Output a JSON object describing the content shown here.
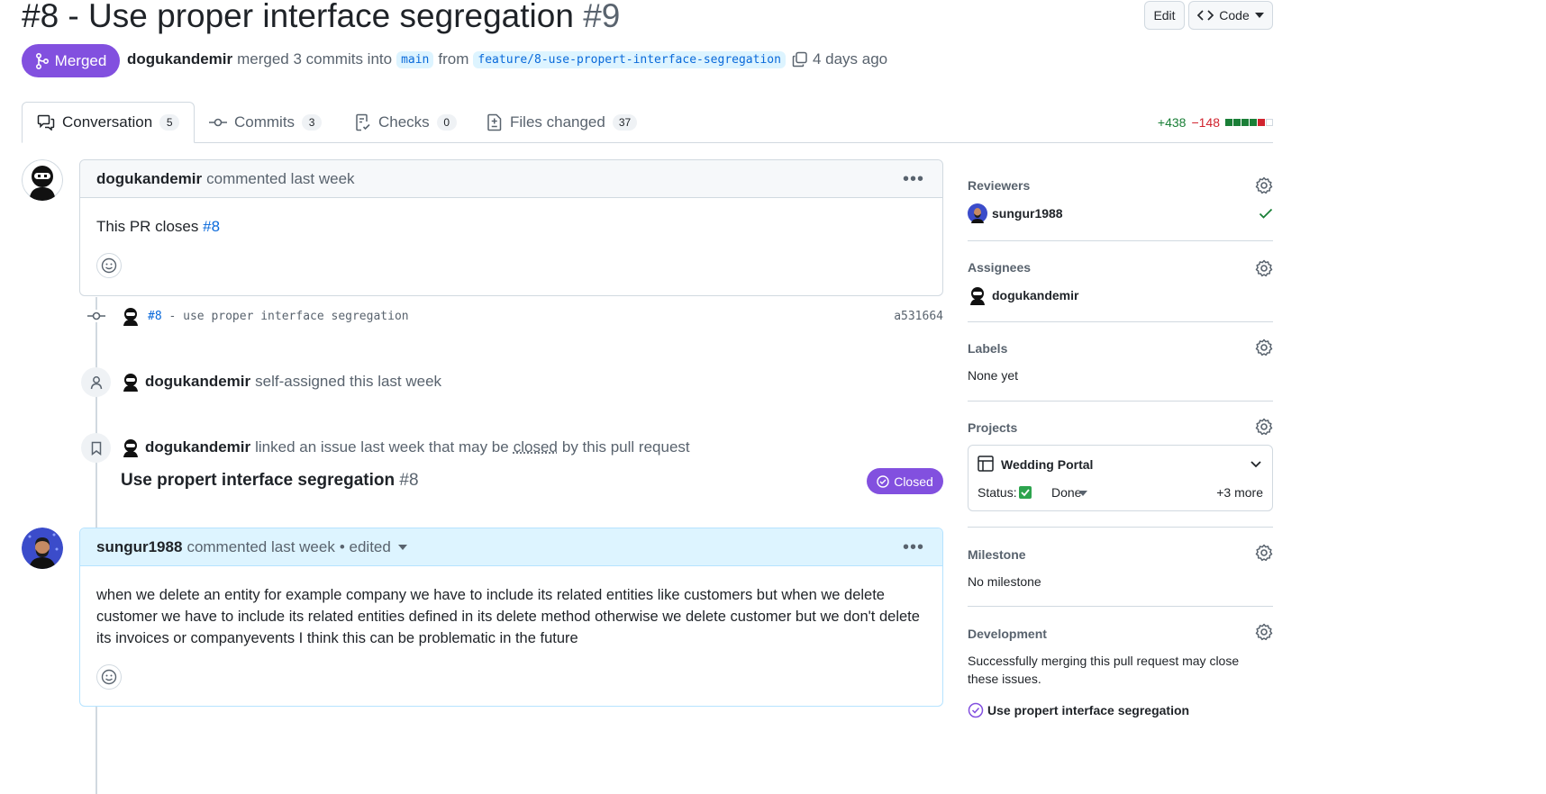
{
  "header": {
    "title": "#8 - Use proper interface segregation",
    "number": "#9",
    "edit_label": "Edit",
    "code_label": "Code"
  },
  "status": {
    "badge": "Merged",
    "author": "dogukandemir",
    "merged_text": "merged 3 commits into",
    "base_branch": "main",
    "from_text": "from",
    "head_branch": "feature/8-use-propert-interface-segregation",
    "time": "4 days ago"
  },
  "tabs": [
    {
      "label": "Conversation",
      "count": "5"
    },
    {
      "label": "Commits",
      "count": "3"
    },
    {
      "label": "Checks",
      "count": "0"
    },
    {
      "label": "Files changed",
      "count": "37"
    }
  ],
  "diffstat": {
    "additions": "+438",
    "deletions": "−148"
  },
  "timeline": {
    "comment1": {
      "author": "dogukandemir",
      "meta": "commented last week",
      "body_text": "This PR closes",
      "body_link": "#8"
    },
    "commit": {
      "issue_ref": "#8",
      "message": "- use proper interface segregation",
      "sha": "a531664"
    },
    "assign_event": {
      "author": "dogukandemir",
      "text": "self-assigned this last week"
    },
    "link_event": {
      "author": "dogukandemir",
      "text_pre": "linked an issue last week that may be",
      "text_closed": "closed",
      "text_post": "by this pull request",
      "issue_title": "Use propert interface segregation",
      "issue_number": "#8",
      "issue_state": "Closed"
    },
    "comment2": {
      "author": "sungur1988",
      "meta": "commented last week",
      "edited": "• edited",
      "body": "when we delete an entity for example company we have to include its related entities like customers but when we delete customer we have to include its related entities defined in its delete method otherwise we delete customer but we don't delete its invoices or companyevents I think this can be problematic in the future"
    }
  },
  "sidebar": {
    "reviewers": {
      "title": "Reviewers",
      "user": "sungur1988"
    },
    "assignees": {
      "title": "Assignees",
      "user": "dogukandemir"
    },
    "labels": {
      "title": "Labels",
      "value": "None yet"
    },
    "projects": {
      "title": "Projects",
      "project": "Wedding Portal",
      "status_label": "Status:",
      "status_value": "Done",
      "more": "+3 more"
    },
    "milestone": {
      "title": "Milestone",
      "value": "No milestone"
    },
    "development": {
      "title": "Development",
      "text": "Successfully merging this pull request may close these issues.",
      "issue": "Use propert interface segregation"
    }
  },
  "colors": {
    "merged": "#8250df",
    "link": "#0969da",
    "addition": "#1a7f37",
    "deletion": "#d1242f",
    "check": "#1a7f37",
    "done": "#2da44e"
  }
}
